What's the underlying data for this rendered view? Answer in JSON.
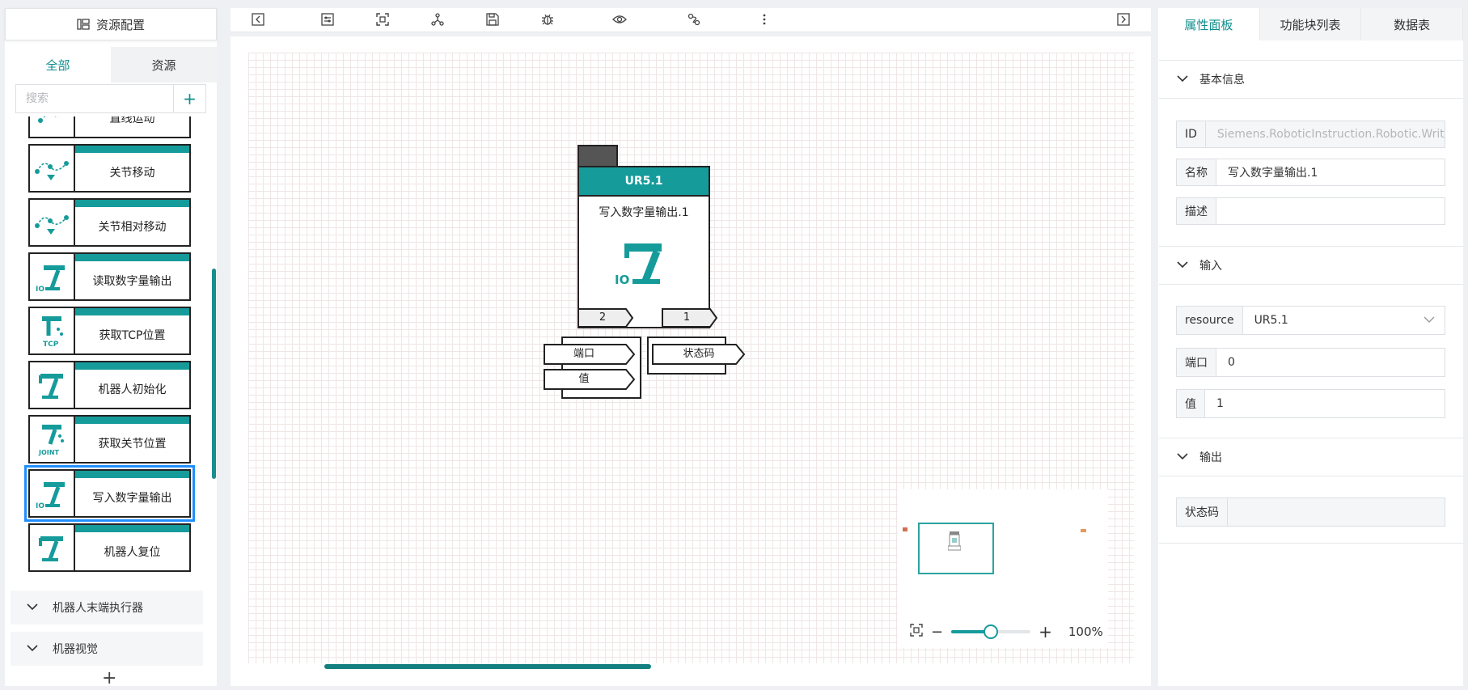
{
  "left_panel": {
    "title": "资源配置",
    "tabs": [
      {
        "label": "全部",
        "active": true
      },
      {
        "label": "资源",
        "active": false
      }
    ],
    "search": {
      "placeholder": "搜索",
      "value": "",
      "add_label": "+"
    },
    "blocks": [
      {
        "label": "直线运动",
        "icon": "linear-motion-icon"
      },
      {
        "label": "关节移动",
        "icon": "joint-move-icon"
      },
      {
        "label": "关节相对移动",
        "icon": "joint-relative-move-icon"
      },
      {
        "label": "读取数字量输出",
        "icon": "io-robot-icon"
      },
      {
        "label": "获取TCP位置",
        "icon": "tcp-robot-icon"
      },
      {
        "label": "机器人初始化",
        "icon": "robot-arm-icon"
      },
      {
        "label": "获取关节位置",
        "icon": "joint-robot-icon"
      },
      {
        "label": "写入数字量输出",
        "icon": "io-robot-icon",
        "selected": true
      },
      {
        "label": "机器人复位",
        "icon": "robot-arm-icon"
      }
    ],
    "categories": [
      {
        "label": "机器人末端执行器"
      },
      {
        "label": "机器视觉"
      }
    ],
    "add_label": "+"
  },
  "toolbar": {
    "icons": [
      "collapse-left-icon",
      "settings-sliders-icon",
      "fit-view-icon",
      "network-icon",
      "save-icon",
      "debug-bug-icon",
      "preview-eye-icon",
      "connect-icon",
      "more-vertical-icon",
      "collapse-right-icon"
    ]
  },
  "canvas": {
    "block": {
      "resource": "UR5.1",
      "name": "写入数字量输出.1",
      "icon": "io-robot-icon",
      "left_count": "2",
      "right_count": "1",
      "inputs": [
        "端口",
        "值"
      ],
      "outputs": [
        "状态码"
      ]
    },
    "zoom": {
      "label": "100%",
      "value": 0.5,
      "minus": "−",
      "plus": "+"
    }
  },
  "right_panel": {
    "tabs": [
      {
        "label": "属性面板",
        "active": true
      },
      {
        "label": "功能块列表",
        "active": false
      },
      {
        "label": "数据表",
        "active": false
      }
    ],
    "sections": {
      "basic": {
        "title": "基本信息",
        "fields": [
          {
            "label": "ID",
            "value": "Siemens.RoboticInstruction.Robotic.WriteDO"
          },
          {
            "label": "名称",
            "value": "写入数字量输出.1"
          },
          {
            "label": "描述",
            "value": ""
          }
        ]
      },
      "input": {
        "title": "输入",
        "fields": [
          {
            "label": "resource",
            "value": "UR5.1"
          },
          {
            "label": "端口",
            "value": "0"
          },
          {
            "label": "值",
            "value": "1"
          }
        ]
      },
      "output": {
        "title": "输出",
        "fields": [
          {
            "label": "状态码",
            "value": ""
          }
        ]
      }
    }
  },
  "colors": {
    "accent": "#169b9b",
    "selection": "#1f8fff",
    "border": "#222222"
  }
}
